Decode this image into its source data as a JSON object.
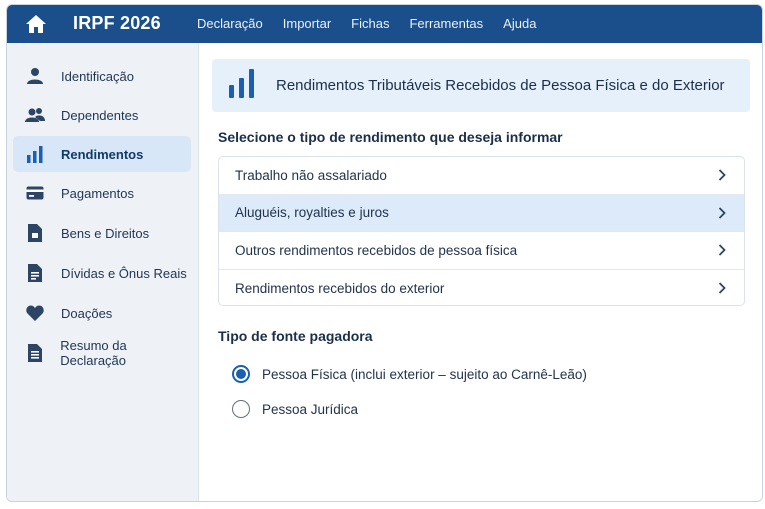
{
  "header": {
    "app_title": "IRPF 2026",
    "home_icon": "home-icon",
    "menu": [
      "Declaração",
      "Importar",
      "Fichas",
      "Ferramentas",
      "Ajuda"
    ]
  },
  "sidebar": {
    "items": [
      {
        "label": "Identificação",
        "icon": "user-icon",
        "active": false
      },
      {
        "label": "Dependentes",
        "icon": "users-icon",
        "active": false
      },
      {
        "label": "Rendimentos",
        "icon": "bar-chart-icon",
        "active": true
      },
      {
        "label": "Pagamentos",
        "icon": "credit-card-icon",
        "active": false
      },
      {
        "label": "Bens e Direitos",
        "icon": "document-icon",
        "active": false
      },
      {
        "label": "Dívidas e Ônus Reais",
        "icon": "document-list-icon",
        "active": false
      },
      {
        "label": "Doações",
        "icon": "heart-icon",
        "active": false
      },
      {
        "label": "Resumo da Declaração",
        "icon": "summary-icon",
        "active": false
      }
    ]
  },
  "main": {
    "section_title": "Rendimentos Tributáveis Recebidos de Pessoa Física e do Exterior",
    "prompt": "Selecione o tipo de rendimento que deseja informar",
    "options": [
      {
        "label": "Trabalho não assalariado",
        "selected": false
      },
      {
        "label": "Aluguéis, royalties e juros",
        "selected": true
      },
      {
        "label": "Outros rendimentos recebidos de pessoa física",
        "selected": false
      },
      {
        "label": "Rendimentos recebidos do exterior",
        "selected": false
      }
    ],
    "payer_label": "Tipo de fonte pagadora",
    "payer_options": [
      {
        "label": "Pessoa Física (inclui exterior – sujeito ao Carnê-Leão)",
        "checked": true
      },
      {
        "label": "Pessoa Jurídica",
        "checked": false
      }
    ]
  },
  "colors": {
    "header_bg": "#1a4f8b",
    "accent": "#1b5fb0",
    "sidebar_bg": "#eef2f7",
    "active_item_bg": "#d8e7f7",
    "selected_row_bg": "#dceafa"
  }
}
